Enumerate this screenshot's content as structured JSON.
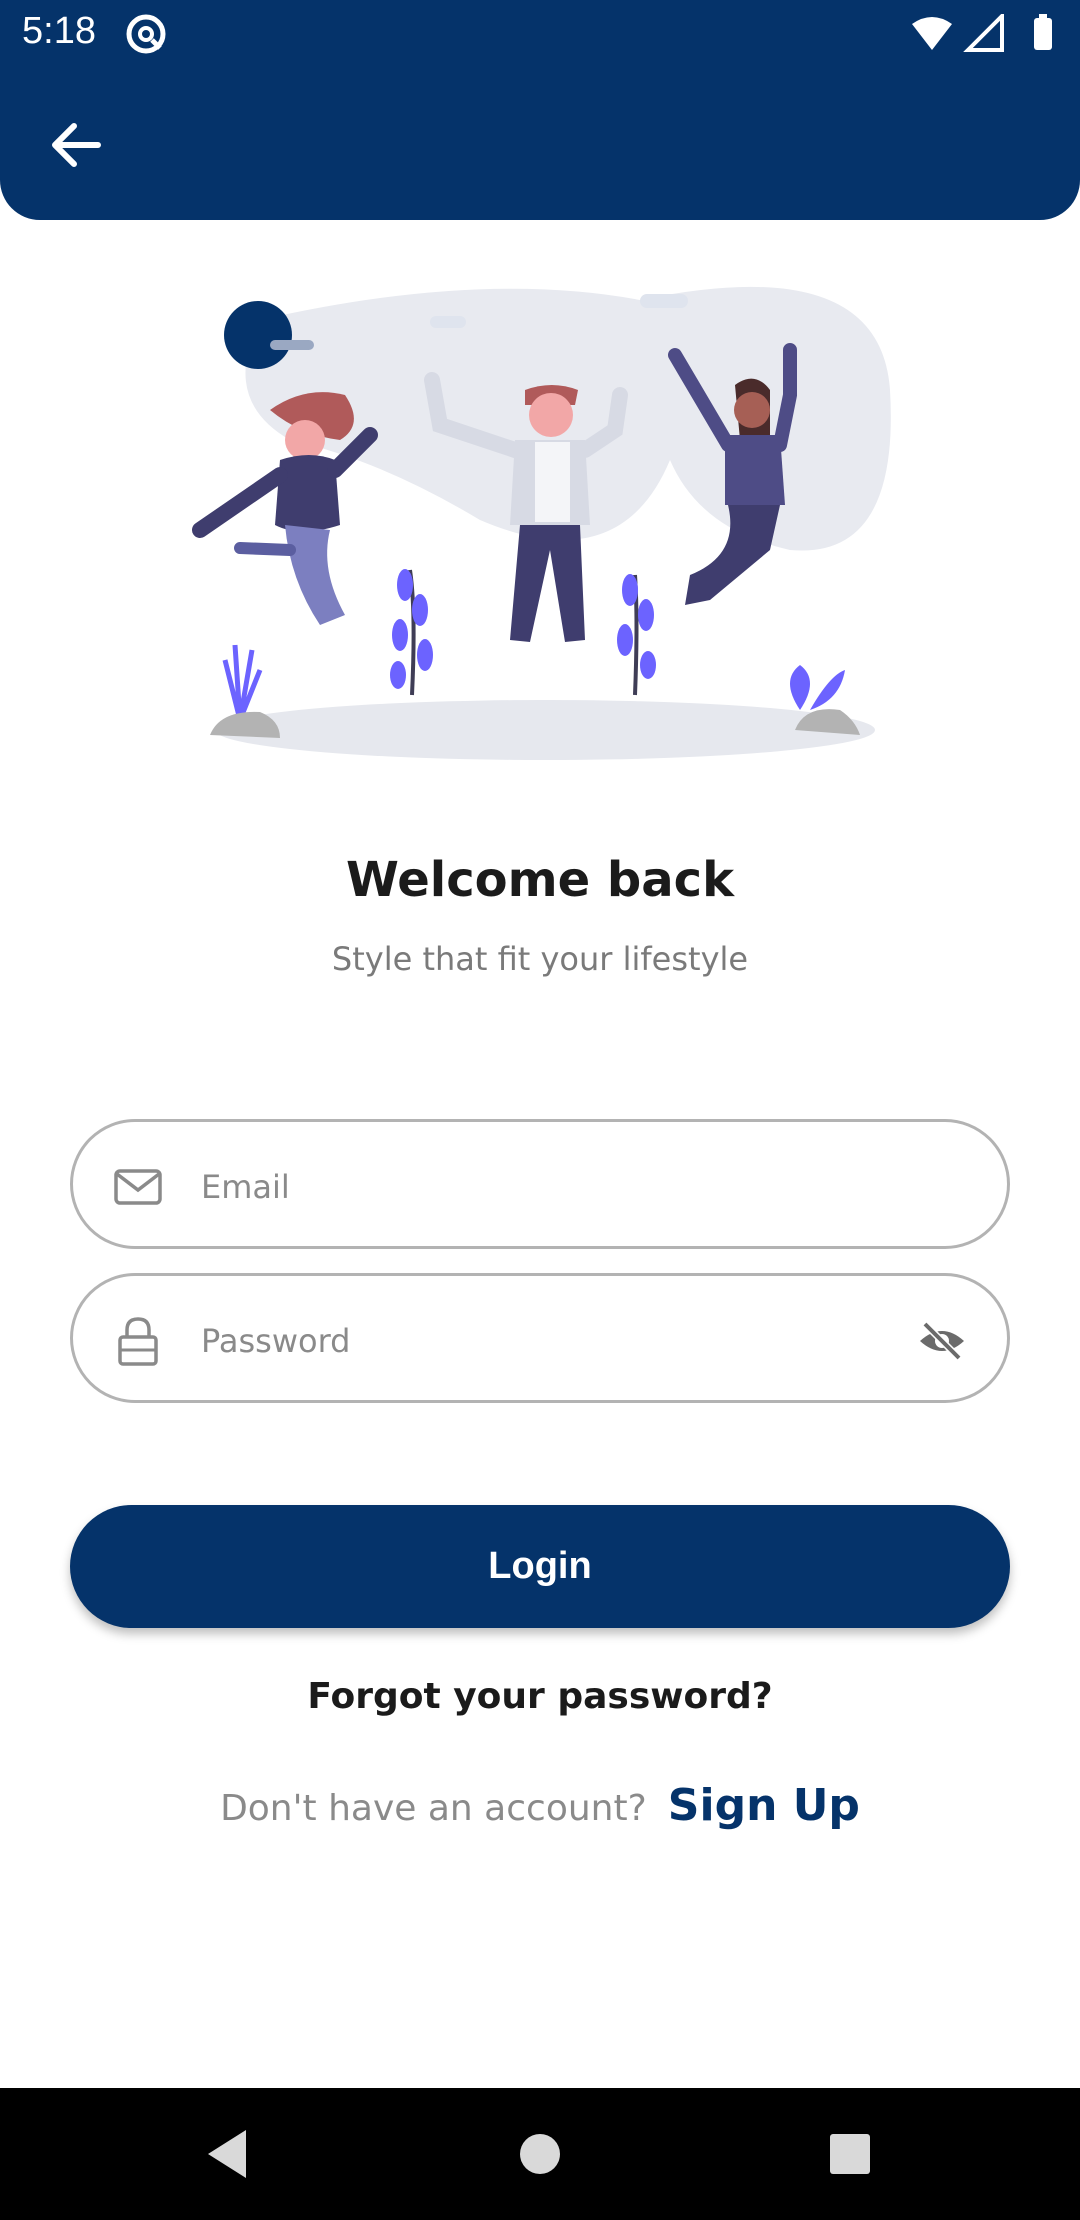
{
  "status_bar": {
    "time": "5:18"
  },
  "icons": {
    "back": "arrow-left-icon",
    "app_status": "at-sign-icon",
    "wifi": "wifi-icon",
    "signal": "signal-icon",
    "battery": "battery-icon",
    "email": "mail-icon",
    "password": "lock-icon",
    "visibility": "eye-off-icon"
  },
  "welcome": {
    "title": "Welcome back",
    "subtitle": "Style that fit your lifestyle"
  },
  "form": {
    "email_placeholder": "Email",
    "password_placeholder": "Password"
  },
  "actions": {
    "login_label": "Login",
    "forgot_label": "Forgot your password?",
    "signup_prompt": "Don't have an account?",
    "signup_label": "Sign Up"
  },
  "colors": {
    "primary": "#05336a",
    "accent_purple": "#6c63ff",
    "background": "#ffffff"
  }
}
